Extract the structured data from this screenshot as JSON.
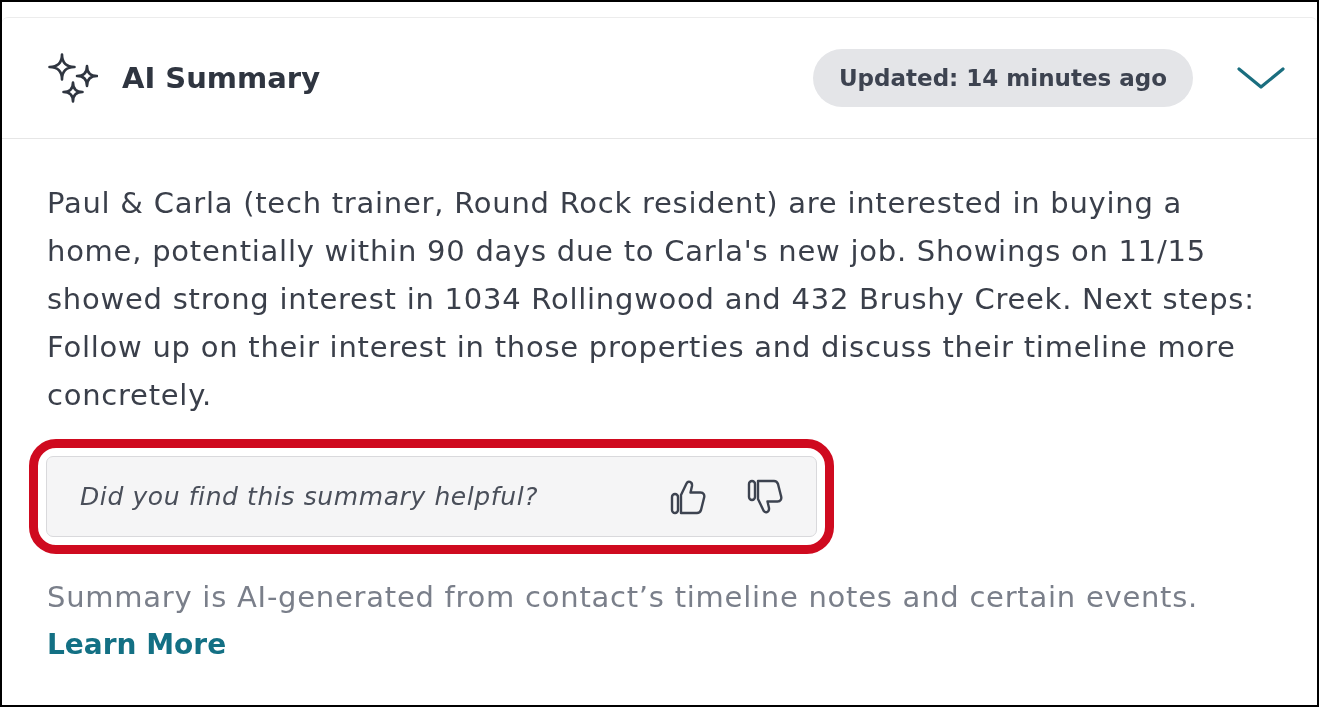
{
  "panel": {
    "title": "AI Summary",
    "updated_badge": "Updated: 14 minutes ago",
    "expanded": true,
    "summary": "Paul & Carla (tech trainer, Round Rock resident) are interested in buying a home, potentially within 90 days due to Carla's new job. Showings on 11/15 showed strong interest in 1034 Rollingwood and 432 Brushy Creek. Next steps: Follow up on their interest in those properties and discuss their timeline more concretely.",
    "feedback": {
      "prompt": "Did you find this summary helpful?",
      "highlighted": true
    },
    "disclaimer": "Summary is AI-generated from contact’s timeline notes and certain events.",
    "learn_more_link": "Learn More"
  }
}
